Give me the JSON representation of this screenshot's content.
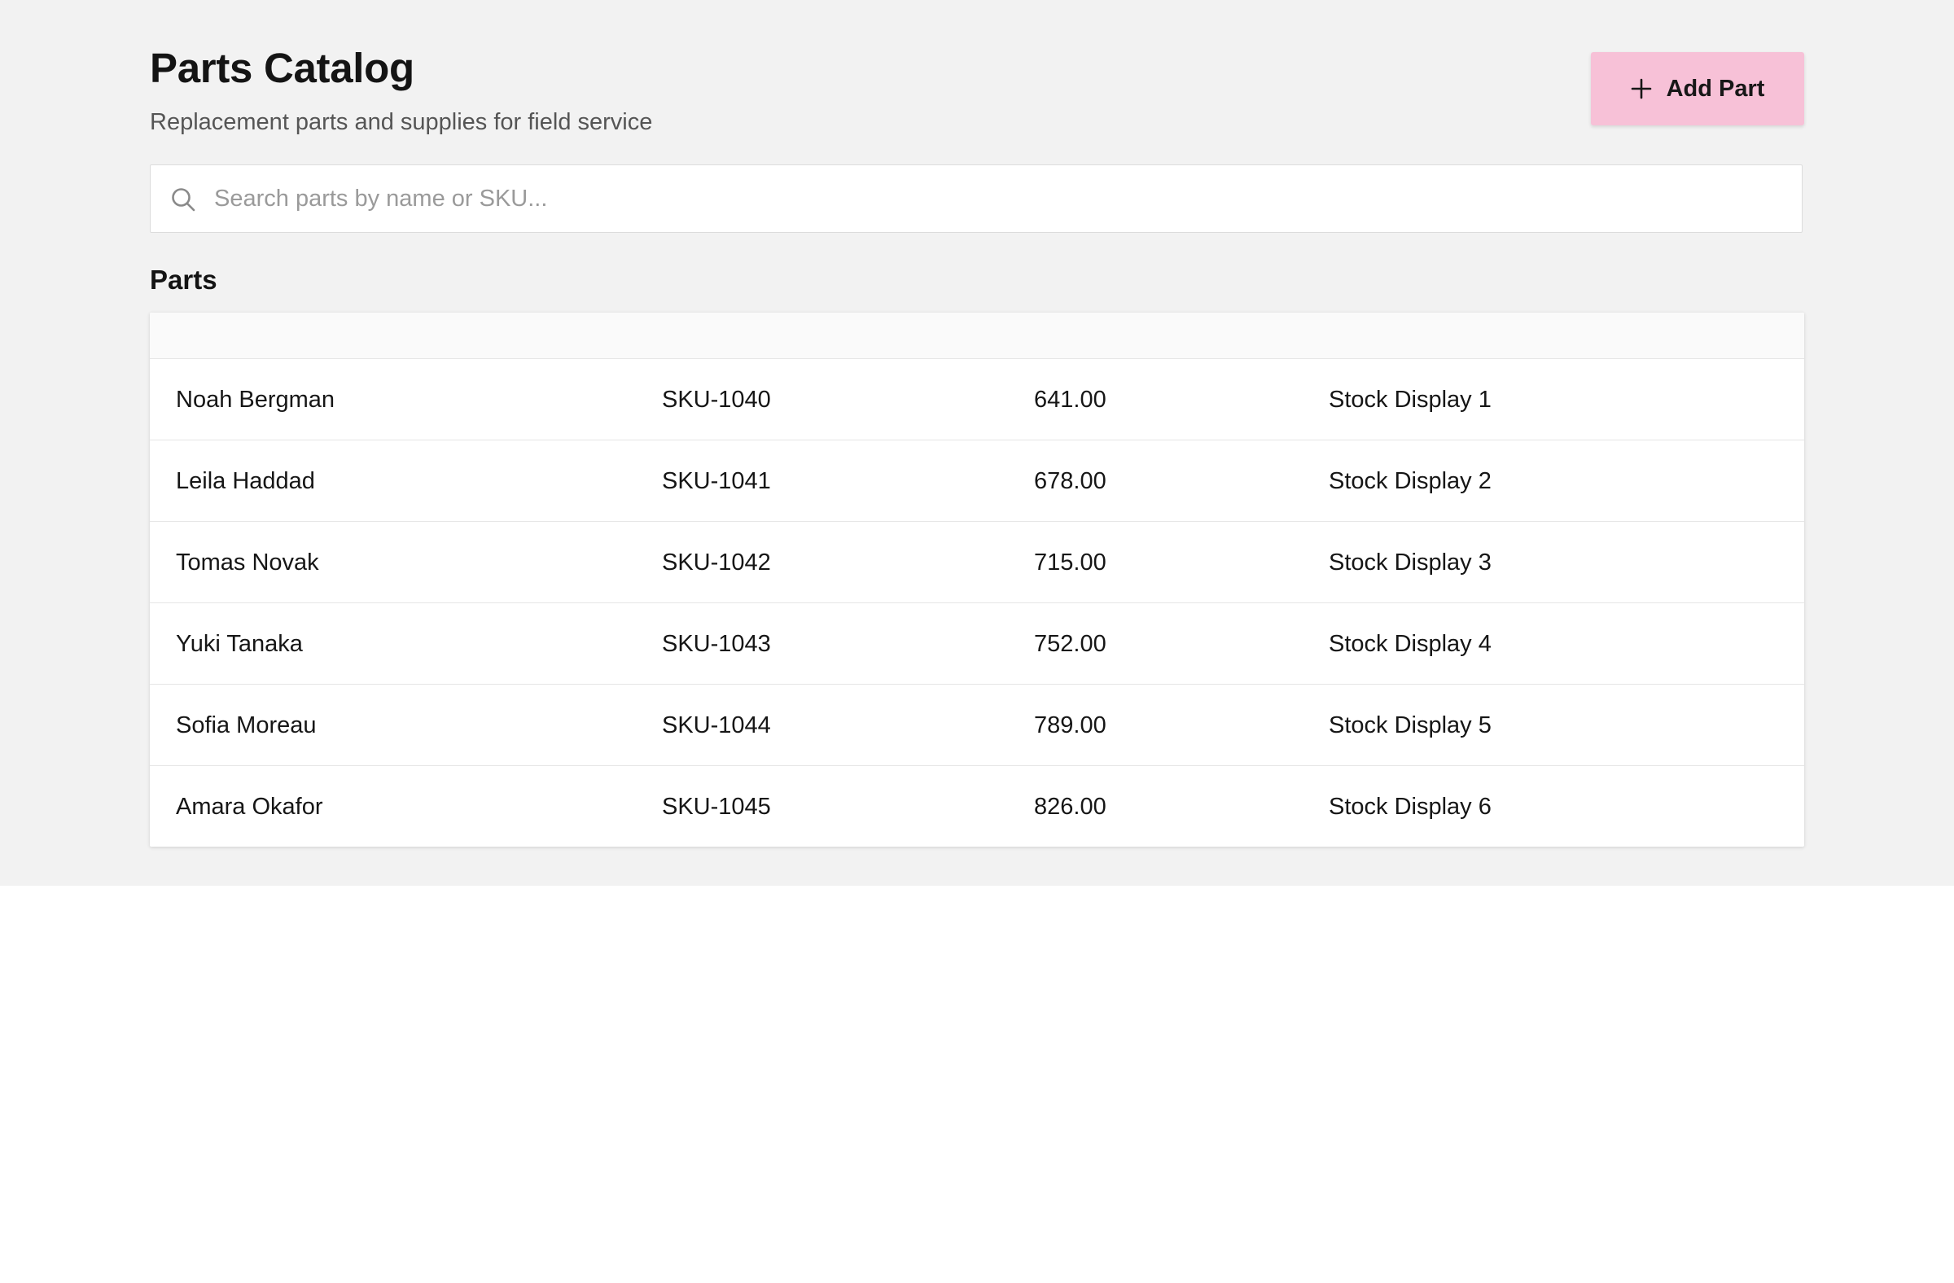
{
  "header": {
    "title": "Parts Catalog",
    "subtitle": "Replacement parts and supplies for field service",
    "add_button_label": "Add Part"
  },
  "search": {
    "placeholder": "Search parts by name or SKU...",
    "value": ""
  },
  "parts_section": {
    "title": "Parts",
    "rows": [
      {
        "name": "Noah Bergman",
        "sku": "SKU-1040",
        "price": "641.00",
        "stock": "Stock Display 1"
      },
      {
        "name": "Leila Haddad",
        "sku": "SKU-1041",
        "price": "678.00",
        "stock": "Stock Display 2"
      },
      {
        "name": "Tomas Novak",
        "sku": "SKU-1042",
        "price": "715.00",
        "stock": "Stock Display 3"
      },
      {
        "name": "Yuki Tanaka",
        "sku": "SKU-1043",
        "price": "752.00",
        "stock": "Stock Display 4"
      },
      {
        "name": "Sofia Moreau",
        "sku": "SKU-1044",
        "price": "789.00",
        "stock": "Stock Display 5"
      },
      {
        "name": "Amara Okafor",
        "sku": "SKU-1045",
        "price": "826.00",
        "stock": "Stock Display 6"
      }
    ]
  },
  "icons": {
    "add_button": "plus-icon",
    "search": "search-icon"
  },
  "colors": {
    "accent": "#f7c1d7",
    "page_background": "#f2f2f2"
  }
}
